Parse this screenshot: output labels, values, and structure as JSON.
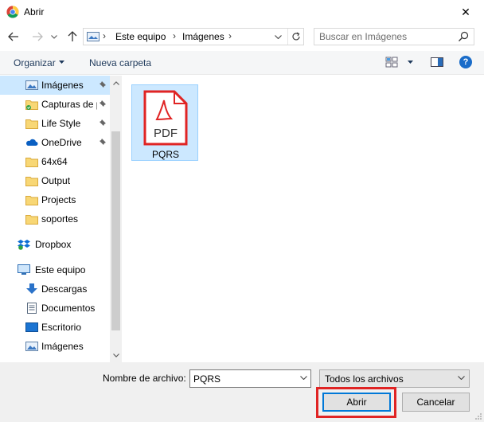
{
  "window": {
    "title": "Abrir",
    "close_glyph": "✕"
  },
  "navigation": {
    "breadcrumb": [
      "Este equipo",
      "Imágenes"
    ],
    "search_placeholder": "Buscar en Imágenes"
  },
  "toolbar": {
    "organize_label": "Organizar",
    "new_folder_label": "Nueva carpeta",
    "help_glyph": "?"
  },
  "sidebar": {
    "items": [
      {
        "label": "Imágenes",
        "icon": "pictures-folder-icon",
        "pinned": true,
        "selected": true
      },
      {
        "label": "Capturas de p",
        "icon": "folder-synced-icon",
        "pinned": true,
        "selected": false
      },
      {
        "label": "Life Style",
        "icon": "folder-icon",
        "pinned": true,
        "selected": false
      },
      {
        "label": "OneDrive",
        "icon": "onedrive-cloud-icon",
        "pinned": true,
        "selected": false
      },
      {
        "label": "64x64",
        "icon": "folder-icon",
        "pinned": false,
        "selected": false
      },
      {
        "label": "Output",
        "icon": "folder-icon",
        "pinned": false,
        "selected": false
      },
      {
        "label": "Projects",
        "icon": "folder-icon",
        "pinned": false,
        "selected": false
      },
      {
        "label": "soportes",
        "icon": "folder-icon",
        "pinned": false,
        "selected": false
      },
      {
        "label": "Dropbox",
        "icon": "dropbox-icon",
        "pinned": false,
        "selected": false
      },
      {
        "label": "Este equipo",
        "icon": "computer-icon",
        "pinned": false,
        "selected": false
      },
      {
        "label": "Descargas",
        "icon": "downloads-icon",
        "pinned": false,
        "selected": false
      },
      {
        "label": "Documentos",
        "icon": "documents-icon",
        "pinned": false,
        "selected": false
      },
      {
        "label": "Escritorio",
        "icon": "desktop-icon",
        "pinned": false,
        "selected": false
      },
      {
        "label": "Imágenes",
        "icon": "pictures-folder-icon",
        "pinned": false,
        "selected": false
      }
    ]
  },
  "files": [
    {
      "name": "PQRS",
      "icon": "pdf-file-icon",
      "icon_text": "PDF",
      "selected": true
    }
  ],
  "footer": {
    "filename_label": "Nombre de archivo:",
    "filename_value": "PQRS",
    "filter_value": "Todos los archivos",
    "open_label": "Abrir",
    "cancel_label": "Cancelar"
  },
  "colors": {
    "selection": "#cce8ff",
    "highlight_outline": "#e02424",
    "pdf_red": "#e02424"
  }
}
